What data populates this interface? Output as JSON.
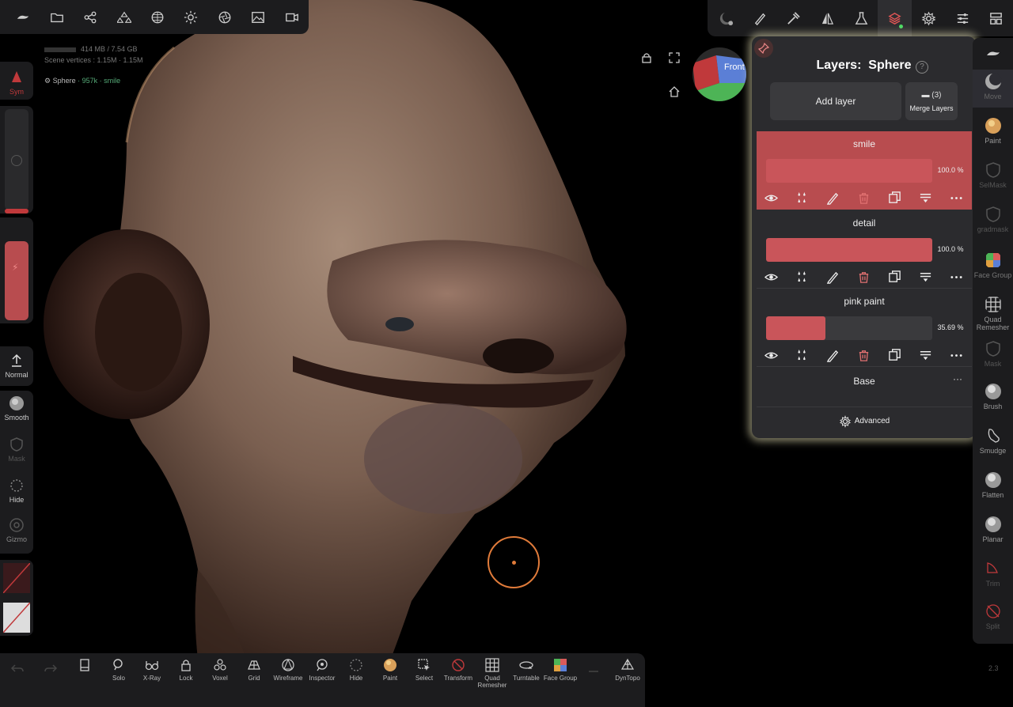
{
  "stats": {
    "memory": "414 MB / 7.54 GB",
    "scene_vertices": "Scene vertices : 1.15M · 1.15M"
  },
  "object_info": {
    "name": "Sphere",
    "count": "· 957k ·",
    "layer": "smile"
  },
  "left_panel": {
    "normal": "Normal",
    "smooth": "Smooth",
    "mask": "Mask",
    "hide": "Hide",
    "gizmo": "Gizmo",
    "sym": "Sym"
  },
  "cube": {
    "label": "Front"
  },
  "layers_panel": {
    "title": "Layers:",
    "object": "Sphere",
    "help": "?",
    "add_layer": "Add layer",
    "merge_count": "(3)",
    "merge_label": "Merge Layers",
    "layers": [
      {
        "name": "smile",
        "value": "100.0 %",
        "fill": 1.0,
        "active": true
      },
      {
        "name": "detail",
        "value": "100.0 %",
        "fill": 1.0,
        "active": false
      },
      {
        "name": "pink paint",
        "value": "35.69 %",
        "fill": 0.3569,
        "active": false
      }
    ],
    "base": "Base",
    "more": "···",
    "advanced": "Advanced"
  },
  "right_tools": {
    "move": "Move",
    "paint": "Paint",
    "selmask": "SelMask",
    "gradmask": "gradmask",
    "face_group": "Face Group",
    "quad_remesher": "Quad Remesher",
    "mask": "Mask",
    "brush": "Brush",
    "smudge": "Smudge",
    "flatten": "Flatten",
    "planar": "Planar",
    "trim": "Trim",
    "split": "Split"
  },
  "bottom_tools": {
    "solo": "Solo",
    "xray": "X-Ray",
    "lock": "Lock",
    "voxel": "Voxel",
    "grid": "Grid",
    "wireframe": "Wireframe",
    "inspector": "Inspector",
    "hide": "Hide",
    "paint": "Paint",
    "select": "Select",
    "transform": "Transform",
    "quad_remesher": "Quad Remesher",
    "turntable": "Turntable",
    "face_group": "Face Group",
    "dyntopo": "DynTopo"
  },
  "version": "2.3",
  "colors": {
    "accent": "#b84c4f",
    "glow": "#f0ebbe",
    "brush_cursor": "#e07b3a"
  }
}
